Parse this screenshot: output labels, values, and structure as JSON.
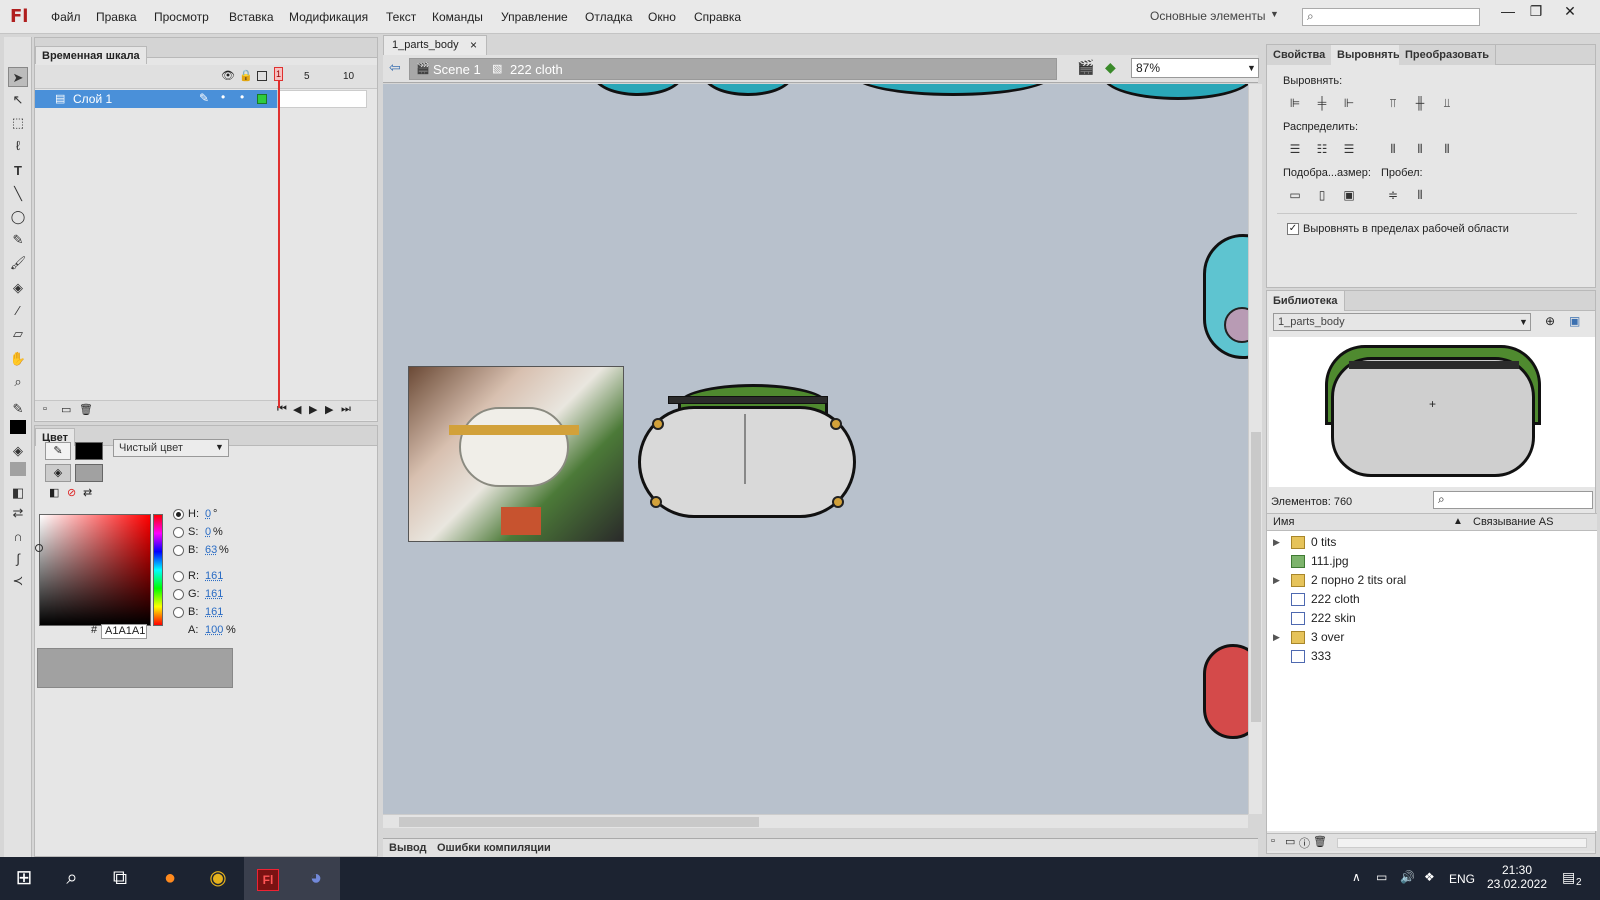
{
  "app": {
    "logo": "Fl"
  },
  "menu": [
    "Файл",
    "Правка",
    "Просмотр",
    "Вставка",
    "Модификация",
    "Текст",
    "Команды",
    "Управление",
    "Отладка",
    "Окно",
    "Справка"
  ],
  "workspace": "Основные элементы",
  "window_controls": [
    "—",
    "❐",
    "✕"
  ],
  "timeline": {
    "tab": "Временная шкала",
    "ruler": [
      "1",
      "5",
      "10"
    ],
    "layer": "Слой 1"
  },
  "color_panel": {
    "tab": "Цвет",
    "fill_type": "Чистый цвет",
    "fields": [
      {
        "label": "H:",
        "value": "0",
        "unit": "°"
      },
      {
        "label": "S:",
        "value": "0",
        "unit": "%"
      },
      {
        "label": "B:",
        "value": "63",
        "unit": "%"
      },
      {
        "label": "R:",
        "value": "161",
        "unit": ""
      },
      {
        "label": "G:",
        "value": "161",
        "unit": ""
      },
      {
        "label": "B:",
        "value": "161",
        "unit": ""
      },
      {
        "label": "A:",
        "value": "100",
        "unit": "%"
      }
    ],
    "hex_prefix": "#",
    "hex": "A1A1A1",
    "color": "#a1a1a1"
  },
  "document": {
    "tab": "1_parts_body",
    "close": "×",
    "breadcrumbs": [
      "Scene 1",
      "222 cloth"
    ],
    "zoom": "87%"
  },
  "bottom_tabs": [
    "Вывод",
    "Ошибки компиляции"
  ],
  "properties": {
    "tabs": [
      "Свойства",
      "Выровнять",
      "Преобразовать"
    ],
    "align_label": "Выровнять:",
    "distribute_label": "Распределить:",
    "match_size_label": "Подобра...азмер:",
    "space_label": "Пробел:",
    "stage_checkbox": "Выровнять в пределах рабочей области"
  },
  "library": {
    "tab": "Библиотека",
    "document": "1_parts_body",
    "count_label": "Элементов: 760",
    "columns": [
      "Имя",
      "Связывание AS"
    ],
    "items": [
      {
        "name": "0 tits",
        "type": "folder"
      },
      {
        "name": "111.jpg",
        "type": "bitmap"
      },
      {
        "name": "2 порно 2 tits oral",
        "type": "folder"
      },
      {
        "name": "222 cloth",
        "type": "symbol"
      },
      {
        "name": "222 skin",
        "type": "symbol"
      },
      {
        "name": "3 over",
        "type": "folder"
      },
      {
        "name": "333",
        "type": "symbol"
      }
    ]
  },
  "taskbar": {
    "lang": "ENG",
    "time": "21:30",
    "date": "23.02.2022",
    "notifications": "2"
  },
  "colors": {
    "accent": "#4a90d9",
    "stage": "#b8c1cc",
    "playhead": "#e0302f",
    "taskbar": "#1c2331"
  }
}
